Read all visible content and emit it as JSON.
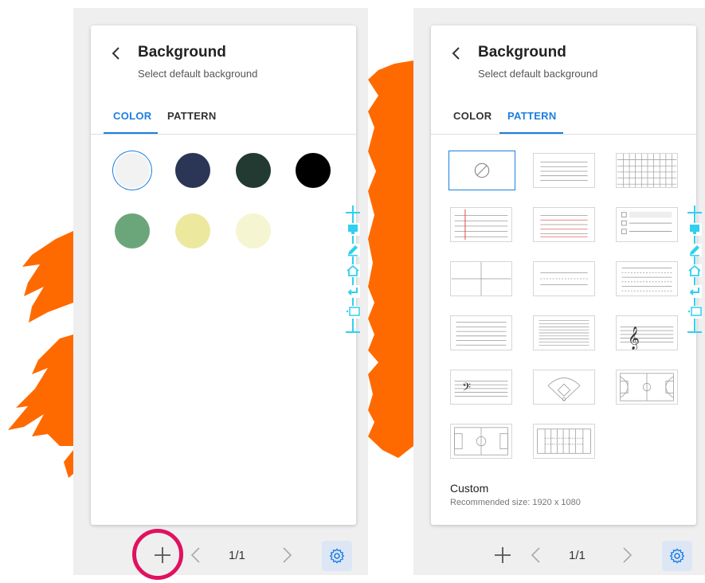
{
  "screens": [
    {
      "title": "Background",
      "subtitle": "Select default background",
      "tabs": [
        {
          "label": "COLOR",
          "active": true
        },
        {
          "label": "PATTERN",
          "active": false
        }
      ],
      "colors": [
        "#f2f2f2",
        "#2b3656",
        "#233a33",
        "#000000",
        "#6aa679",
        "#ece89e",
        "#f5f5d2"
      ],
      "selected_color": "#f2f2f2",
      "page_indicator": "1/1"
    },
    {
      "title": "Background",
      "subtitle": "Select default background",
      "tabs": [
        {
          "label": "COLOR",
          "active": false
        },
        {
          "label": "PATTERN",
          "active": true
        }
      ],
      "patterns": [
        "none",
        "lines",
        "grid",
        "notebook-red-margin",
        "red-lines",
        "checklist",
        "quadrants",
        "dashed-lines",
        "dashed-lines-small",
        "wide-lines",
        "narrow-lines",
        "treble-clef-staff",
        "bass-clef-staff",
        "baseball-field",
        "basketball-court",
        "soccer-field",
        "football-field"
      ],
      "selected_pattern": "none",
      "custom_title": "Custom",
      "custom_note": "Recommended size: 1920 x 1080",
      "page_indicator": "1/1"
    }
  ],
  "colors": {
    "accent": "#1c7fe0",
    "splash": "#ff6a00",
    "toolbar": "#2fd0f0",
    "highlight": "#e0115f"
  },
  "icons": [
    "back-icon",
    "plus-icon",
    "chevron-left-icon",
    "chevron-right-icon",
    "settings-gear-icon",
    "display-icon",
    "pen-icon",
    "home-icon",
    "undo-icon",
    "pq-icon",
    "no-pattern-icon"
  ]
}
